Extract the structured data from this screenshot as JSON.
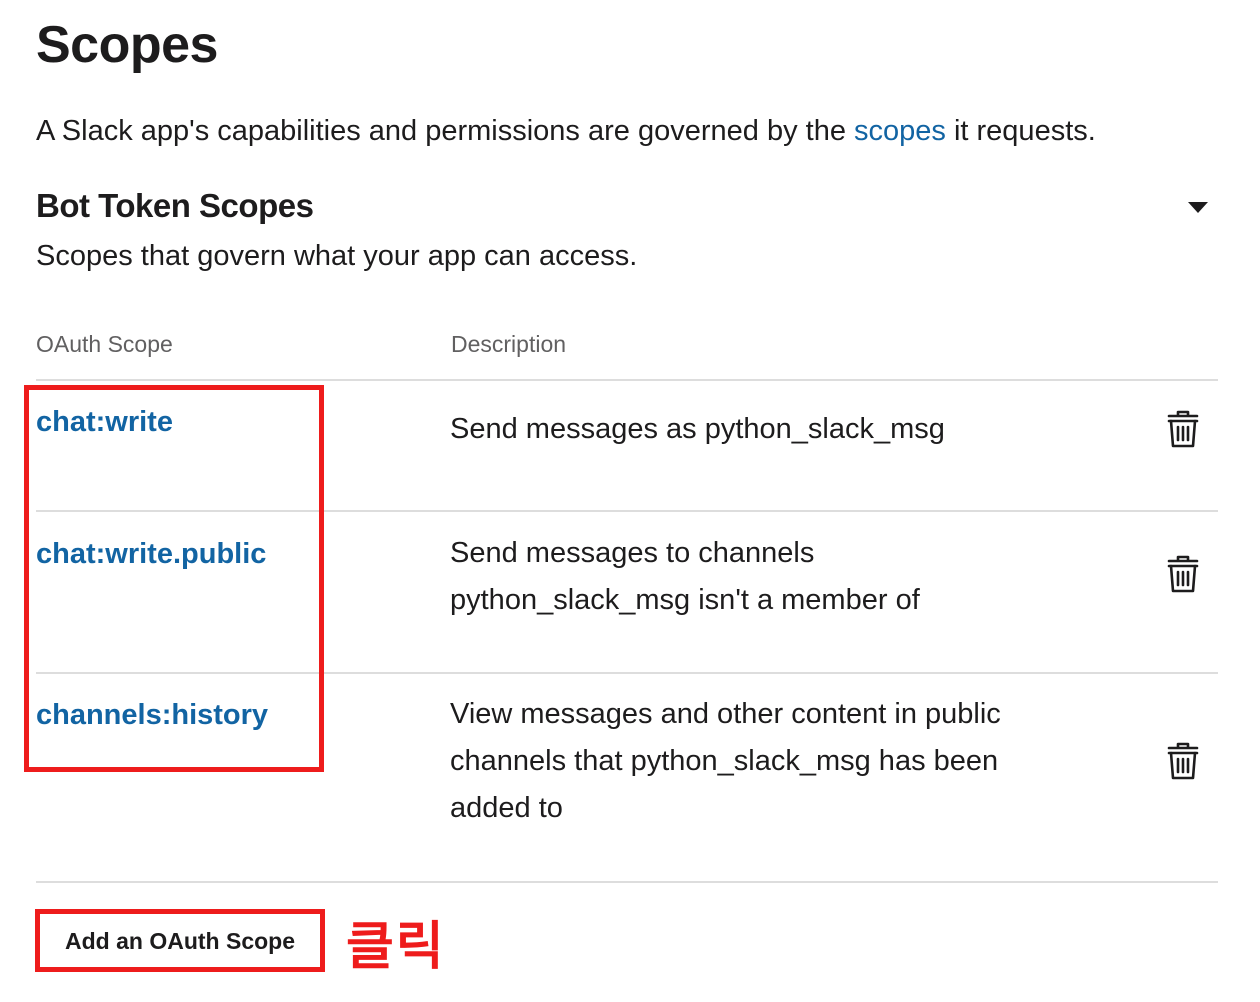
{
  "page": {
    "title": "Scopes",
    "intro_before": "A Slack app's capabilities and permissions are governed by the ",
    "intro_link": "scopes",
    "intro_after": " it requests."
  },
  "section": {
    "title": "Bot Token Scopes",
    "subtitle": "Scopes that govern what your app can access.",
    "toggle_icon": "caret-down-icon"
  },
  "table": {
    "headers": {
      "scope": "OAuth Scope",
      "description": "Description"
    },
    "rows": [
      {
        "scope": "chat:write",
        "description": "Send messages as python_slack_msg",
        "action_icon": "trash-icon"
      },
      {
        "scope": "chat:write.public",
        "description": "Send messages to channels python_slack_msg isn't a member of",
        "action_icon": "trash-icon"
      },
      {
        "scope": "channels:history",
        "description": "View messages and other content in public channels that python_slack_msg has been added to",
        "action_icon": "trash-icon"
      }
    ]
  },
  "actions": {
    "add_scope_label": "Add an OAuth Scope"
  },
  "annotation": {
    "text": "클릭",
    "color": "#ee1c1c"
  },
  "colors": {
    "link": "#1264a3",
    "text": "#1d1c1d",
    "muted": "#616061",
    "highlight": "#ee1c1c"
  }
}
